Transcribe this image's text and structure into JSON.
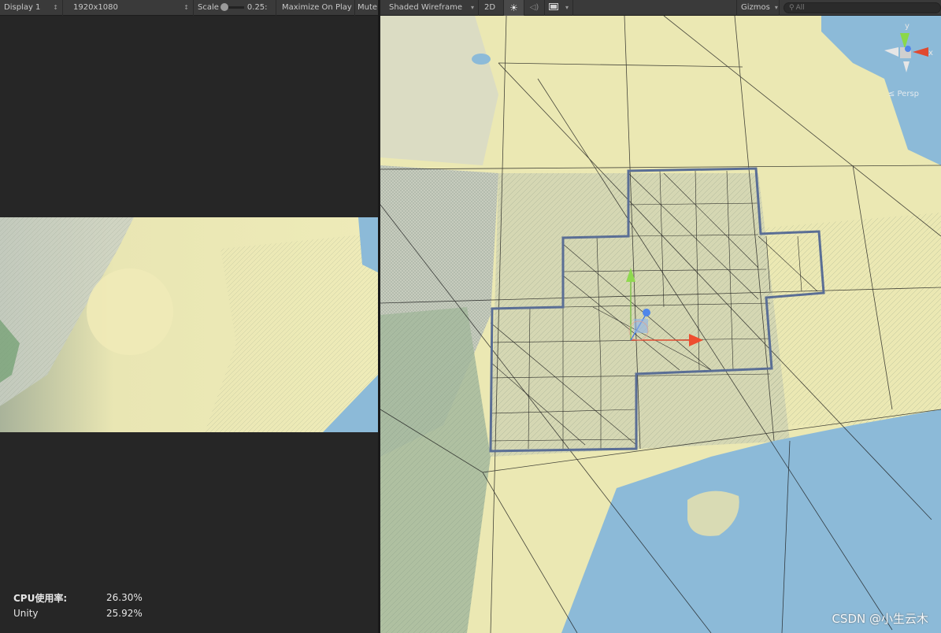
{
  "game_toolbar": {
    "display": "Display 1",
    "resolution": "1920x1080",
    "scale_label": "Scale",
    "scale_value": "0.25:",
    "maximize": "Maximize On Play",
    "mute": "Mute"
  },
  "scene_toolbar": {
    "draw_mode": "Shaded Wireframe",
    "mode_2d": "2D",
    "gizmos": "Gizmos",
    "search_placeholder": "All"
  },
  "scene": {
    "view_label": "Persp",
    "gizmo_axis_y": "y",
    "gizmo_axis_x": "x"
  },
  "stats": {
    "cpu_label": "CPU使用率:",
    "cpu_value": "26.30%",
    "unity_label": "Unity",
    "unity_value": "25.92%"
  },
  "watermark": "CSDN @小生云木",
  "colors": {
    "panel_bg": "#282828",
    "toolbar_bg": "#3a3a3a",
    "land": "#ece9b0",
    "sea": "#8cbad8",
    "highlight_grid": "#5a6e95"
  }
}
